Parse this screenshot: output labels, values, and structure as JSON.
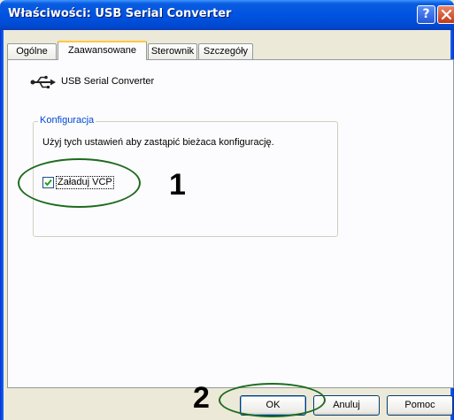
{
  "window": {
    "title": "Właściwości: USB Serial Converter",
    "help_label": "?"
  },
  "tabs": [
    {
      "label": "Ogólne"
    },
    {
      "label": "Zaawansowane"
    },
    {
      "label": "Sterownik"
    },
    {
      "label": "Szczegóły"
    }
  ],
  "active_tab": "Zaawansowane",
  "device": {
    "name": "USB Serial Converter",
    "icon": "usb-icon"
  },
  "configuration": {
    "group_title": "Konfiguracja",
    "description": "Użyj tych ustawień aby zastąpić bieżaca konfigurację.",
    "checkbox_label": "Załaduj VCP",
    "checkbox_checked": true
  },
  "annotations": {
    "marker_1": "1",
    "marker_2": "2",
    "color": "#1d6b1d"
  },
  "buttons": {
    "ok": "OK",
    "cancel": "Anuluj",
    "help": "Pomoc"
  }
}
